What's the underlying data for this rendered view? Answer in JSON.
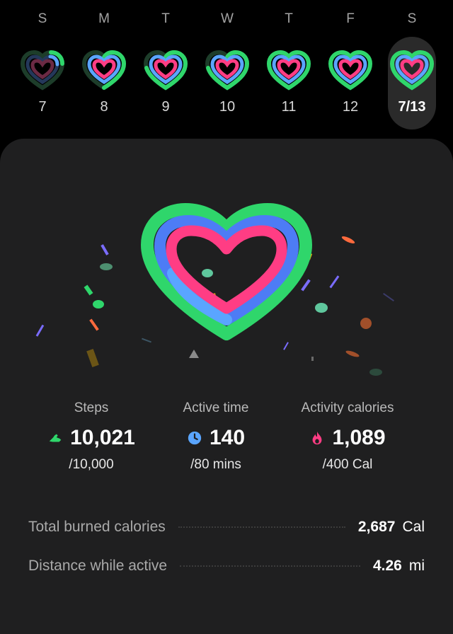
{
  "week": {
    "days": [
      {
        "dow": "S",
        "date": "7"
      },
      {
        "dow": "M",
        "date": "8"
      },
      {
        "dow": "T",
        "date": "9"
      },
      {
        "dow": "W",
        "date": "10"
      },
      {
        "dow": "T",
        "date": "11"
      },
      {
        "dow": "F",
        "date": "12"
      },
      {
        "dow": "S",
        "date": "7/13"
      }
    ],
    "selected_index": 6
  },
  "colors": {
    "steps_ring": "#2fd66b",
    "active_ring": "#5aa5ff",
    "calories_ring": "#ff3d84",
    "card_bg": "#1f1f20"
  },
  "stats": {
    "steps": {
      "label": "Steps",
      "value": "10,021",
      "goal": "/10,000",
      "icon": "shoe-icon"
    },
    "active_time": {
      "label": "Active time",
      "value": "140",
      "goal": "/80 mins",
      "icon": "clock-icon"
    },
    "calories": {
      "label": "Activity calories",
      "value": "1,089",
      "goal": "/400 Cal",
      "icon": "flame-icon"
    }
  },
  "details": {
    "total_burned": {
      "label": "Total burned calories",
      "value": "2,687",
      "unit": "Cal"
    },
    "distance": {
      "label": "Distance while active",
      "value": "4.26",
      "unit": "mi"
    }
  }
}
